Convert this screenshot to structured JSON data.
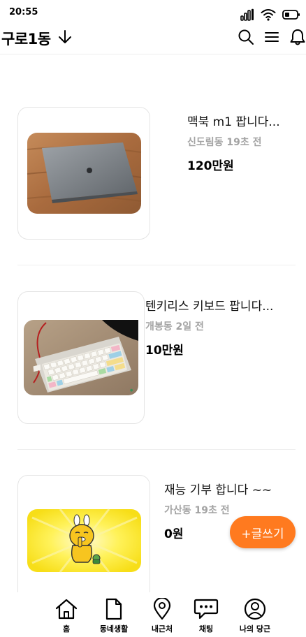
{
  "status_bar": {
    "time": "20:55"
  },
  "header": {
    "location": "구로1동"
  },
  "posts": [
    {
      "title": "맥북 m1 팝니다...",
      "location": "신도림동",
      "time_ago": "19초 전",
      "price": "120만원",
      "image": "laptop-photo"
    },
    {
      "title": "텐키리스 키보드 팝니다...",
      "location": "개봉동",
      "time_ago": "2일 전",
      "price": "10만원",
      "image": "keyboard-photo"
    },
    {
      "title": "재능 기부 합니다 ~~",
      "location": "가산동",
      "time_ago": "19초 전",
      "price": "0원",
      "image": "character-illustration"
    }
  ],
  "write_button": {
    "label": "+글쓰기"
  },
  "tabs": [
    {
      "label": "홈",
      "icon": "home-icon"
    },
    {
      "label": "동네생활",
      "icon": "document-icon"
    },
    {
      "label": "내근처",
      "icon": "location-pin-icon"
    },
    {
      "label": "채팅",
      "icon": "chat-icon"
    },
    {
      "label": "나의 당근",
      "icon": "profile-icon"
    }
  ],
  "colors": {
    "accent": "#ff7a1f",
    "meta_text": "#a3a3a3",
    "divider": "#eeeeee"
  }
}
